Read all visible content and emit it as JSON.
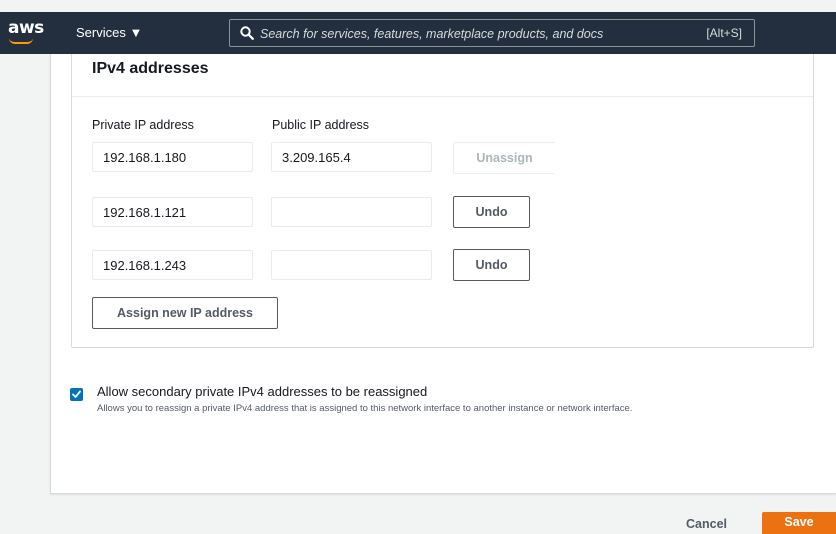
{
  "header": {
    "logo_text": "aws",
    "services_label": "Services ▼",
    "search_placeholder": "Search for services, features, marketplace products, and docs",
    "search_shortcut": "[Alt+S]"
  },
  "ipv4": {
    "title": "IPv4 addresses",
    "col_private": "Private IP address",
    "col_public": "Public IP address",
    "rows": [
      {
        "private_ip": "192.168.1.180",
        "public_ip": "3.209.165.4",
        "action": "Unassign"
      },
      {
        "private_ip": "192.168.1.121",
        "public_ip": "",
        "action": "Undo"
      },
      {
        "private_ip": "192.168.1.243",
        "public_ip": "",
        "action": "Undo"
      }
    ],
    "assign_button": "Assign new IP address"
  },
  "reassign": {
    "checked": true,
    "label": "Allow secondary private IPv4 addresses to be reassigned",
    "description": "Allows you to reassign a private IPv4 address that is assigned to this network interface to another instance or network interface."
  },
  "footer": {
    "cancel_label": "Cancel",
    "save_label": "Save"
  },
  "colors": {
    "header_bg": "#232f3e",
    "accent_orange": "#ec7211",
    "checkbox_blue": "#0073bb"
  }
}
